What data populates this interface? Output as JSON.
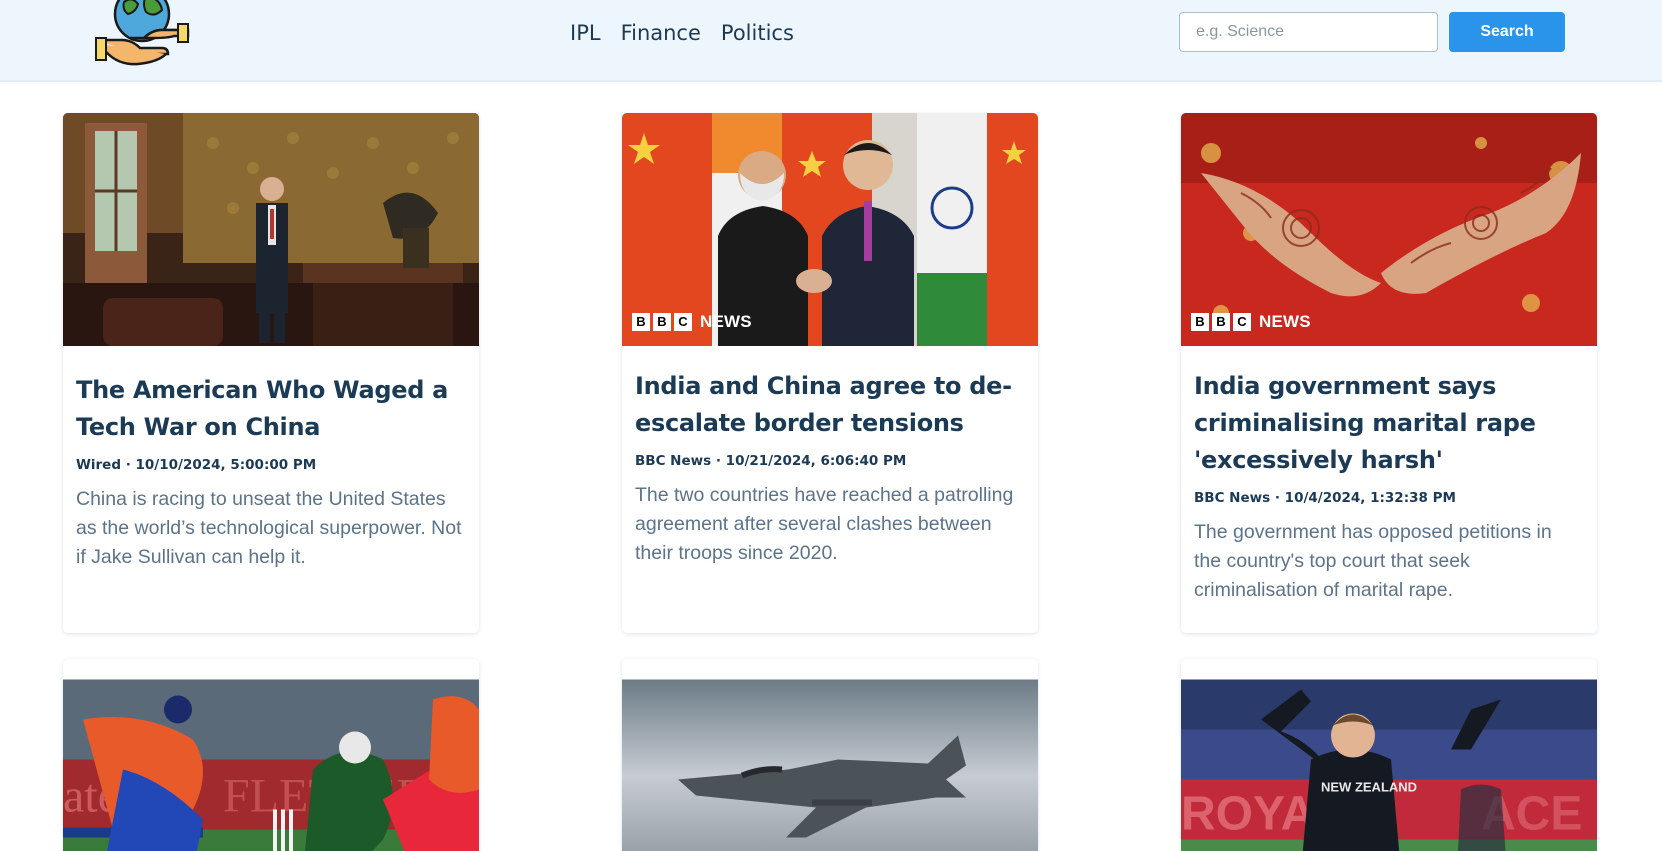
{
  "header": {
    "logo_name": "globe-in-hands-logo",
    "nav": [
      "IPL",
      "Finance",
      "Politics"
    ],
    "search": {
      "placeholder": "e.g. Science",
      "value": "",
      "button_label": "Search"
    },
    "colors": {
      "accent": "#2a93ea",
      "nav_bg": "#eef6fd",
      "text": "#1e3a52"
    }
  },
  "bbc_logo": {
    "letters": [
      "B",
      "B",
      "C"
    ],
    "word": "NEWS"
  },
  "cards": [
    {
      "title": "The American Who Waged a Tech War on China",
      "meta": "Wired · 10/10/2024, 5:00:00 PM",
      "description": "China is racing to unseat the United States as the world’s technological superpower. Not if Jake Sullivan can help it.",
      "image": "man-in-suit-in-ornate-office-photo"
    },
    {
      "title": "India and China agree to de-escalate border tensions",
      "meta": "BBC News · 10/21/2024, 6:06:40 PM",
      "description": "The two countries have reached a patrolling agreement after several clashes between their troops since 2020.",
      "image": "leaders-handshake-with-flags-photo"
    },
    {
      "title": "India government says criminalising marital rape 'excessively harsh'",
      "meta": "BBC News · 10/4/2024, 1:32:38 PM",
      "description": "The government has opposed petitions in the country's top court that seek criminalisation of marital rape.",
      "image": "henna-hands-bridal-photo"
    },
    {
      "image": "cricket-match-photo"
    },
    {
      "image": "fighter-jet-photo"
    },
    {
      "image": "cricketer-appeal-photo"
    }
  ]
}
